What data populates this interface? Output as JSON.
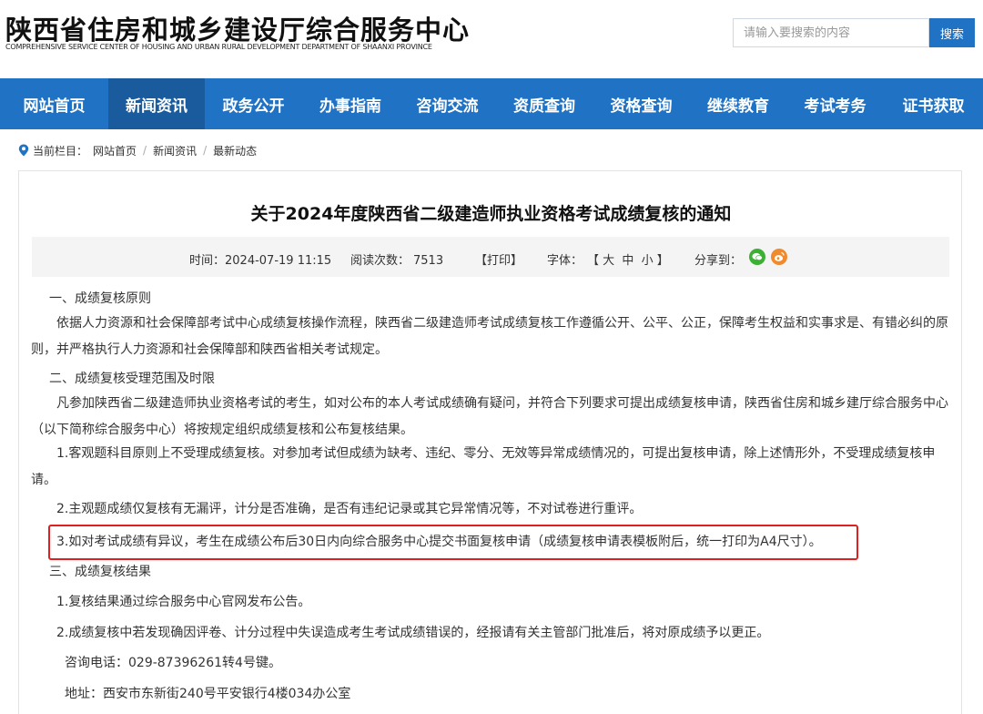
{
  "header": {
    "title": "陕西省住房和城乡建设厅综合服务中心",
    "subtitle": "COMPREHENSIVE SERVICE CENTER OF HOUSING AND URBAN RURAL DEVELOPMENT DEPARTMENT OF SHAANXI PROVINCE",
    "search_placeholder": "请输入要搜索的内容",
    "search_button": "搜索"
  },
  "nav": {
    "items": [
      {
        "label": "网站首页"
      },
      {
        "label": "新闻资讯"
      },
      {
        "label": "政务公开"
      },
      {
        "label": "办事指南"
      },
      {
        "label": "咨询交流"
      },
      {
        "label": "资质查询"
      },
      {
        "label": "资格查询"
      },
      {
        "label": "继续教育"
      },
      {
        "label": "考试考务"
      },
      {
        "label": "证书获取"
      }
    ],
    "active_index": 1
  },
  "breadcrumb": {
    "prefix": "当前栏目：",
    "items": [
      "网站首页",
      "新闻资讯",
      "最新动态"
    ],
    "separator": "/"
  },
  "article": {
    "title": "关于2024年度陕西省二级建造师执业资格考试成绩复核的通知",
    "meta": {
      "time_label": "时间：",
      "time": "2024-07-19 11:15",
      "reads_label": "阅读次数：",
      "reads": "7513",
      "print": "【打印】",
      "font_label": "字体：",
      "font_sizes": "【 大  中  小 】",
      "share_label": "分享到："
    },
    "paragraphs": {
      "s1_heading": "一、成绩复核原则",
      "s1_p1": "依据人力资源和社会保障部考试中心成绩复核操作流程，陕西省二级建造师考试成绩复核工作遵循公开、公平、公正，保障考生权益和实事求是、有错必纠的原则，并严格执行人力资源和社会保障部和陕西省相关考试规定。",
      "s2_heading": "二、成绩复核受理范围及时限",
      "s2_p1": "凡参加陕西省二级建造师执业资格考试的考生，如对公布的本人考试成绩确有疑问，并符合下列要求可提出成绩复核申请，陕西省住房和城乡建厅综合服务中心（以下简称综合服务中心）将按规定组织成绩复核和公布复核结果。",
      "s2_item1": "1.客观题科目原则上不受理成绩复核。对参加考试但成绩为缺考、违纪、零分、无效等异常成绩情况的，可提出复核申请，除上述情形外，不受理成绩复核申请。",
      "s2_item2": "2.主观题成绩仅复核有无漏评，计分是否准确，是否有违纪记录或其它异常情况等，不对试卷进行重评。",
      "s2_item3": "3.如对考试成绩有异议，考生在成绩公布后30日内向综合服务中心提交书面复核申请（成绩复核申请表模板附后，统一打印为A4尺寸）。",
      "s3_heading": "三、成绩复核结果",
      "s3_item1": "1.复核结果通过综合服务中心官网发布公告。",
      "s3_item2": "2.成绩复核中若发现确因评卷、计分过程中失误造成考生考试成绩错误的，经报请有关主管部门批准后，将对原成绩予以更正。",
      "phone": "咨询电话：029-87396261转4号键。",
      "address": "地址：西安市东新街240号平安银行4楼034办公室"
    }
  },
  "colors": {
    "nav_bg": "#1f72c4",
    "nav_active_bg": "#1a5b9e",
    "highlight_border": "#e02020",
    "wechat": "#3cb034",
    "weibo": "#f08a2c"
  }
}
